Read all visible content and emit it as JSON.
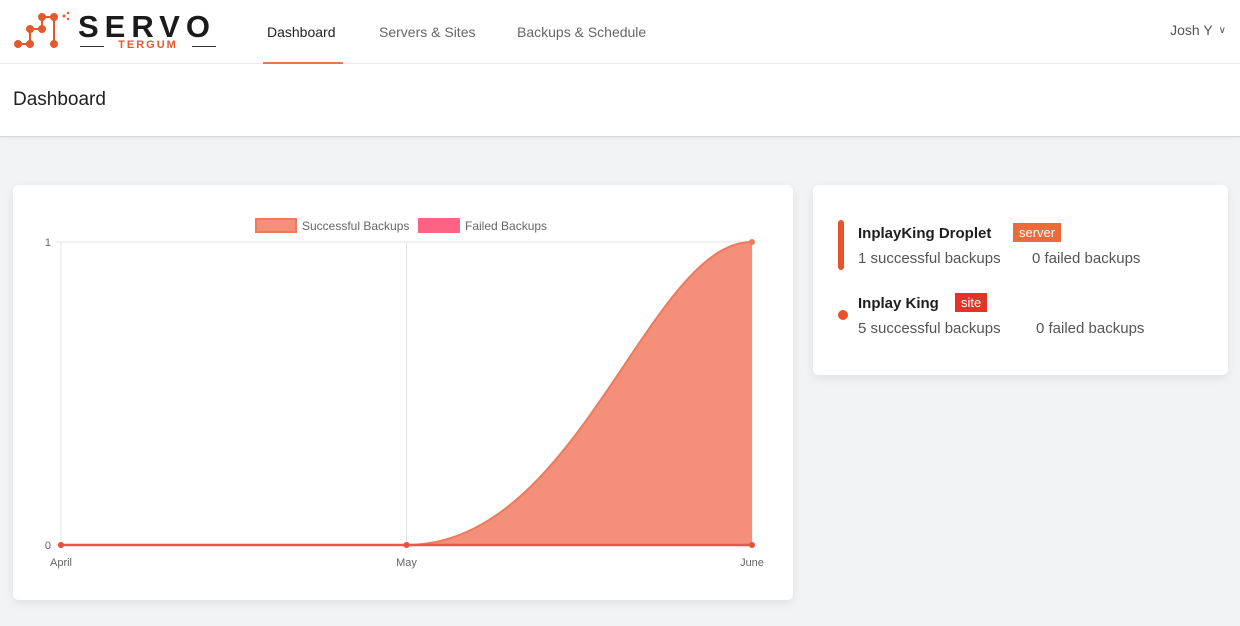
{
  "app": {
    "logo_word": "SERVO",
    "logo_sub": "TERGUM"
  },
  "nav": {
    "items": [
      {
        "label": "Dashboard",
        "active": true
      },
      {
        "label": "Servers & Sites",
        "active": false
      },
      {
        "label": "Backups & Schedule",
        "active": false
      }
    ],
    "user": "Josh Y"
  },
  "page": {
    "title": "Dashboard"
  },
  "chart_data": {
    "type": "area",
    "categories": [
      "April",
      "May",
      "June"
    ],
    "series": [
      {
        "name": "Successful Backups",
        "values": [
          0,
          0,
          1
        ],
        "color": "#f4907a"
      },
      {
        "name": "Failed Backups",
        "values": [
          0,
          0,
          0
        ],
        "color": "#ff6384"
      }
    ],
    "y_ticks": [
      "0",
      "1"
    ],
    "ylim": [
      0,
      1
    ],
    "legend_position": "top",
    "grid": true
  },
  "summary": {
    "items": [
      {
        "name": "InplayKing Droplet",
        "badge": "server",
        "successful": "1 successful backups",
        "failed": "0 failed backups",
        "marker": "bar"
      },
      {
        "name": "Inplay King",
        "badge": "site",
        "successful": "5 successful backups",
        "failed": "0 failed backups",
        "marker": "dot"
      }
    ]
  },
  "colors": {
    "accent": "#e9794f",
    "server_badge": "#ec6a3c",
    "site_badge": "#e5332a"
  }
}
